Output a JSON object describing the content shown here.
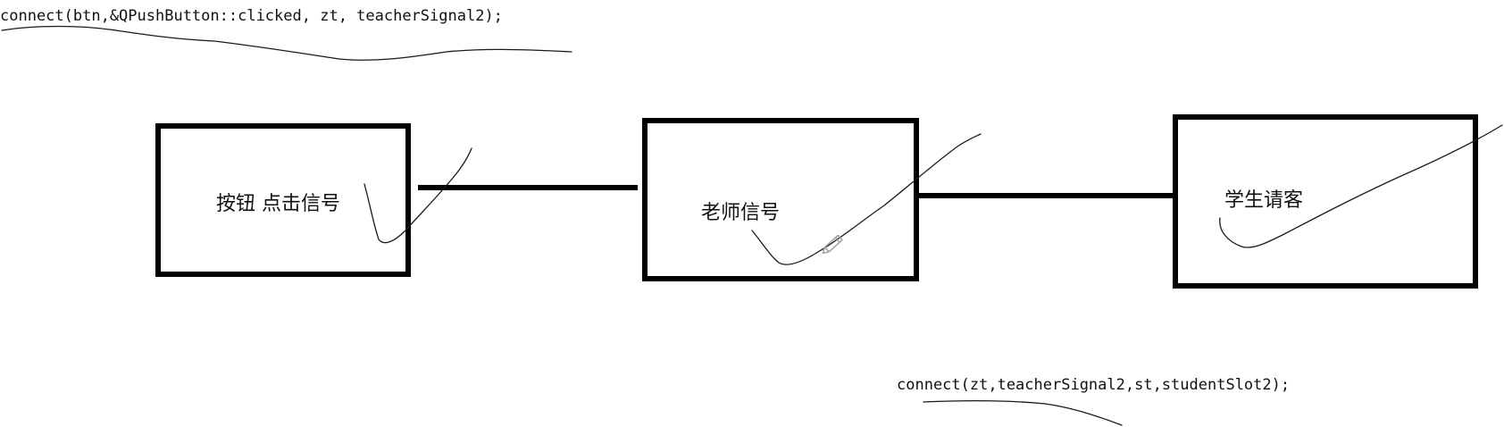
{
  "code": {
    "top": "connect(btn,&QPushButton::clicked, zt, teacherSignal2);",
    "bottom": "connect(zt,teacherSignal2,st,studentSlot2);"
  },
  "boxes": {
    "button": "按钮  点击信号",
    "teacher": "老师信号",
    "student": "学生请客"
  },
  "icons": {
    "pen": "pencil-icon"
  },
  "colors": {
    "stroke": "#000000",
    "background": "#ffffff"
  }
}
